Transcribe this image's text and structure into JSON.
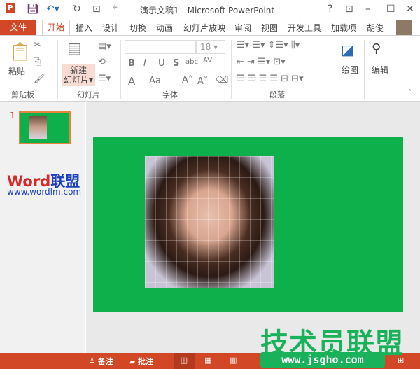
{
  "title": "演示文稿1 - Microsoft PowerPoint",
  "tabs": {
    "file": "文件",
    "items": [
      "开始",
      "插入",
      "设计",
      "切换",
      "动画",
      "幻灯片放映",
      "审阅",
      "视图",
      "开发工具",
      "加载项"
    ],
    "user": "胡俊"
  },
  "ribbon": {
    "clipboard": {
      "paste": "粘贴",
      "label": "剪贴板"
    },
    "slides": {
      "new_slide": "新建",
      "new_slide2": "幻灯片",
      "label": "幻灯片"
    },
    "font": {
      "font_name": "",
      "font_size": "18",
      "label": "字体",
      "bold": "B",
      "italic": "I",
      "underline": "U",
      "shadow": "S",
      "strike": "abc",
      "spacing": "AV",
      "color": "A",
      "case": "Aa"
    },
    "paragraph": {
      "label": "段落"
    },
    "drawing": {
      "label": "绘图"
    },
    "editing": {
      "label": "编辑"
    }
  },
  "thumbnails": [
    {
      "number": "1"
    }
  ],
  "status": {
    "notes": "备注",
    "comments": "批注"
  },
  "watermarks": {
    "word": "Word",
    "word_cn": "联盟",
    "word_url": "www.wordlm.com",
    "jsgho": "技术员联盟",
    "jsgho_url": "www.jsgho.com"
  },
  "colors": {
    "accent": "#D24726",
    "slide_bg": "#0DB04B"
  }
}
